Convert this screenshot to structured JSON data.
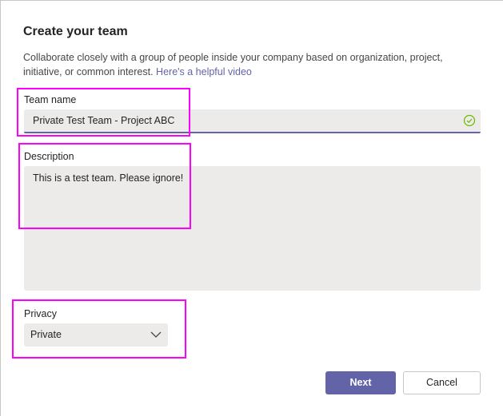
{
  "dialog": {
    "title": "Create your team",
    "subtitle": "Collaborate closely with a group of people inside your company based on organization, project, initiative, or common interest.",
    "help_link": "Here's a helpful video"
  },
  "team_name": {
    "label": "Team name",
    "value": "Private Test Team - Project ABC",
    "status_icon": "check-circle-icon"
  },
  "description": {
    "label": "Description",
    "value": "This is a test team. Please ignore!"
  },
  "privacy": {
    "label": "Privacy",
    "selected": "Private"
  },
  "buttons": {
    "next_label": "Next",
    "cancel_label": "Cancel"
  },
  "colors": {
    "accent": "#6264a7",
    "highlight": "#ff00ff",
    "field_bg": "#edebe9",
    "success": "#6bb700"
  }
}
